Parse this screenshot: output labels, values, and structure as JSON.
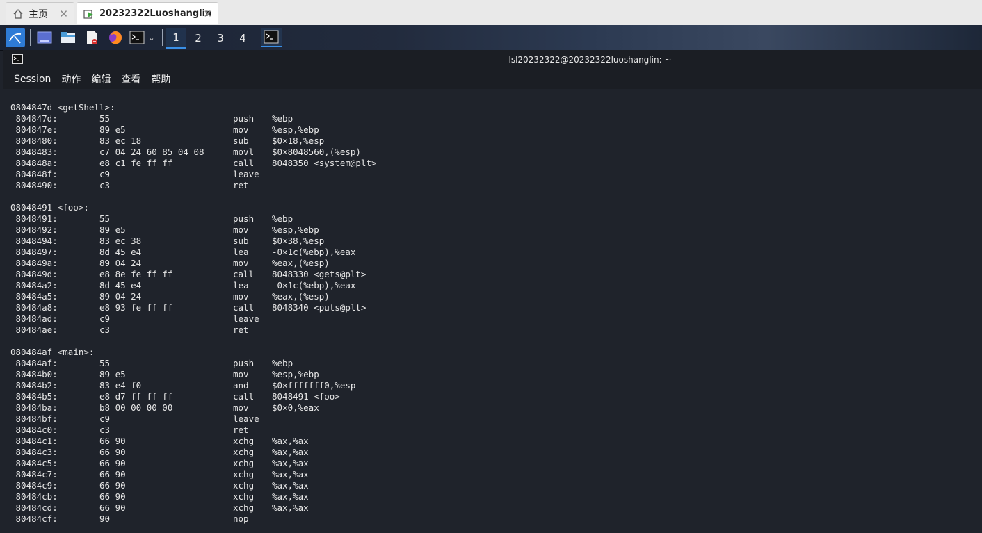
{
  "tabs": [
    {
      "label": "主页",
      "icon": "home-icon"
    },
    {
      "label": "20232322Luoshanglin",
      "icon": "vm-icon"
    }
  ],
  "panel": {
    "workspaces": [
      "1",
      "2",
      "3",
      "4"
    ],
    "active_workspace": "1"
  },
  "window": {
    "title": "lsl20232322@20232322luoshanglin: ~",
    "menu": [
      "Session",
      "动作",
      "编辑",
      "查看",
      "帮助"
    ]
  },
  "disassembly": [
    {
      "label": "0804847d <getShell>:",
      "lines": [
        {
          "addr": " 804847d:",
          "bytes": "55",
          "op": "push",
          "args": "%ebp"
        },
        {
          "addr": " 804847e:",
          "bytes": "89 e5",
          "op": "mov",
          "args": "%esp,%ebp"
        },
        {
          "addr": " 8048480:",
          "bytes": "83 ec 18",
          "op": "sub",
          "args": "$0×18,%esp"
        },
        {
          "addr": " 8048483:",
          "bytes": "c7 04 24 60 85 04 08",
          "op": "movl",
          "args": "$0×8048560,(%esp)"
        },
        {
          "addr": " 804848a:",
          "bytes": "e8 c1 fe ff ff",
          "op": "call",
          "args": "8048350 <system@plt>"
        },
        {
          "addr": " 804848f:",
          "bytes": "c9",
          "op": "leave",
          "args": ""
        },
        {
          "addr": " 8048490:",
          "bytes": "c3",
          "op": "ret",
          "args": ""
        }
      ]
    },
    {
      "label": "08048491 <foo>:",
      "lines": [
        {
          "addr": " 8048491:",
          "bytes": "55",
          "op": "push",
          "args": "%ebp"
        },
        {
          "addr": " 8048492:",
          "bytes": "89 e5",
          "op": "mov",
          "args": "%esp,%ebp"
        },
        {
          "addr": " 8048494:",
          "bytes": "83 ec 38",
          "op": "sub",
          "args": "$0×38,%esp"
        },
        {
          "addr": " 8048497:",
          "bytes": "8d 45 e4",
          "op": "lea",
          "args": "-0×1c(%ebp),%eax"
        },
        {
          "addr": " 804849a:",
          "bytes": "89 04 24",
          "op": "mov",
          "args": "%eax,(%esp)"
        },
        {
          "addr": " 804849d:",
          "bytes": "e8 8e fe ff ff",
          "op": "call",
          "args": "8048330 <gets@plt>"
        },
        {
          "addr": " 80484a2:",
          "bytes": "8d 45 e4",
          "op": "lea",
          "args": "-0×1c(%ebp),%eax"
        },
        {
          "addr": " 80484a5:",
          "bytes": "89 04 24",
          "op": "mov",
          "args": "%eax,(%esp)"
        },
        {
          "addr": " 80484a8:",
          "bytes": "e8 93 fe ff ff",
          "op": "call",
          "args": "8048340 <puts@plt>"
        },
        {
          "addr": " 80484ad:",
          "bytes": "c9",
          "op": "leave",
          "args": ""
        },
        {
          "addr": " 80484ae:",
          "bytes": "c3",
          "op": "ret",
          "args": ""
        }
      ]
    },
    {
      "label": "080484af <main>:",
      "lines": [
        {
          "addr": " 80484af:",
          "bytes": "55",
          "op": "push",
          "args": "%ebp"
        },
        {
          "addr": " 80484b0:",
          "bytes": "89 e5",
          "op": "mov",
          "args": "%esp,%ebp"
        },
        {
          "addr": " 80484b2:",
          "bytes": "83 e4 f0",
          "op": "and",
          "args": "$0×fffffff0,%esp"
        },
        {
          "addr": " 80484b5:",
          "bytes": "e8 d7 ff ff ff",
          "op": "call",
          "args": "8048491 <foo>"
        },
        {
          "addr": " 80484ba:",
          "bytes": "b8 00 00 00 00",
          "op": "mov",
          "args": "$0×0,%eax"
        },
        {
          "addr": " 80484bf:",
          "bytes": "c9",
          "op": "leave",
          "args": ""
        },
        {
          "addr": " 80484c0:",
          "bytes": "c3",
          "op": "ret",
          "args": ""
        },
        {
          "addr": " 80484c1:",
          "bytes": "66 90",
          "op": "xchg",
          "args": "%ax,%ax"
        },
        {
          "addr": " 80484c3:",
          "bytes": "66 90",
          "op": "xchg",
          "args": "%ax,%ax"
        },
        {
          "addr": " 80484c5:",
          "bytes": "66 90",
          "op": "xchg",
          "args": "%ax,%ax"
        },
        {
          "addr": " 80484c7:",
          "bytes": "66 90",
          "op": "xchg",
          "args": "%ax,%ax"
        },
        {
          "addr": " 80484c9:",
          "bytes": "66 90",
          "op": "xchg",
          "args": "%ax,%ax"
        },
        {
          "addr": " 80484cb:",
          "bytes": "66 90",
          "op": "xchg",
          "args": "%ax,%ax"
        },
        {
          "addr": " 80484cd:",
          "bytes": "66 90",
          "op": "xchg",
          "args": "%ax,%ax"
        },
        {
          "addr": " 80484cf:",
          "bytes": "90",
          "op": "nop",
          "args": ""
        }
      ]
    }
  ]
}
